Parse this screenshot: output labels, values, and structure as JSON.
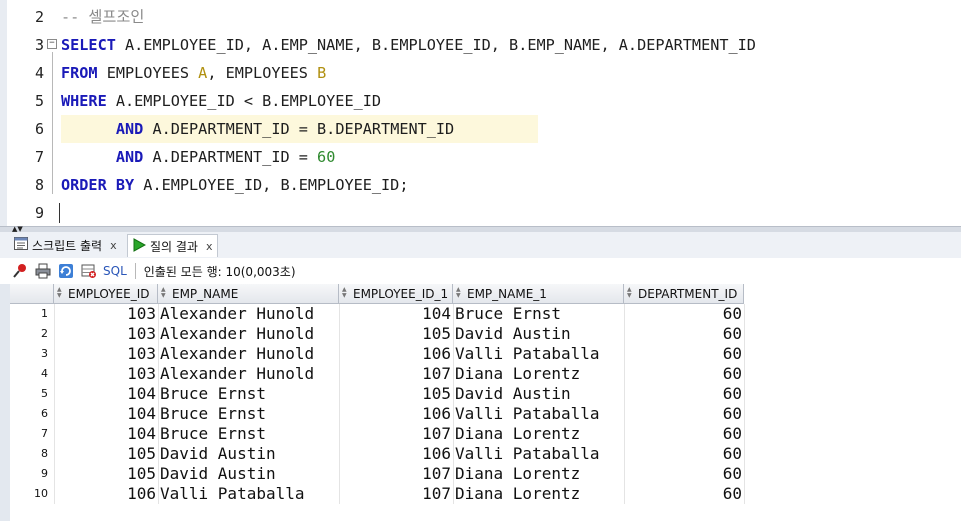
{
  "editor": {
    "lines": [
      {
        "num": "2",
        "tokens": [
          {
            "t": "-- 셀프조인",
            "c": "cm"
          }
        ]
      },
      {
        "num": "3",
        "fold": "⊟",
        "tokens": [
          {
            "t": "SELECT",
            "c": "kw"
          },
          {
            "t": " A.EMPLOYEE_ID, A.EMP_NAME, B.EMPLOYEE_ID, B.EMP_NAME, A.DEPARTMENT_ID",
            "c": ""
          }
        ]
      },
      {
        "num": "4",
        "tokens": [
          {
            "t": "FROM",
            "c": "kw"
          },
          {
            "t": " EMPLOYEES ",
            "c": ""
          },
          {
            "t": "A",
            "c": "alias"
          },
          {
            "t": ", EMPLOYEES ",
            "c": ""
          },
          {
            "t": "B",
            "c": "alias"
          }
        ]
      },
      {
        "num": "5",
        "tokens": [
          {
            "t": "WHERE",
            "c": "kw"
          },
          {
            "t": " A.EMPLOYEE_ID < B.EMPLOYEE_ID",
            "c": ""
          }
        ]
      },
      {
        "num": "6",
        "current": true,
        "tokens": [
          {
            "t": "      ",
            "c": ""
          },
          {
            "t": "AND",
            "c": "kw"
          },
          {
            "t": " A.DEPARTMENT_ID = B.DEPARTMENT_ID",
            "c": ""
          }
        ]
      },
      {
        "num": "7",
        "tokens": [
          {
            "t": "      ",
            "c": ""
          },
          {
            "t": "AND",
            "c": "kw"
          },
          {
            "t": " A.DEPARTMENT_ID = ",
            "c": ""
          },
          {
            "t": "60",
            "c": "num"
          }
        ]
      },
      {
        "num": "8",
        "tokens": [
          {
            "t": "ORDER BY",
            "c": "kw"
          },
          {
            "t": " A.EMPLOYEE_ID, B.EMPLOYEE_ID;",
            "c": ""
          }
        ]
      },
      {
        "num": "9",
        "caret": true,
        "tokens": []
      }
    ]
  },
  "tabs": [
    {
      "label": "스크립트 출력",
      "close": "x",
      "icon": "script-output-icon",
      "active": false
    },
    {
      "label": "질의 결과",
      "close": "x",
      "icon": "run-query-icon",
      "active": true
    }
  ],
  "toolbar": {
    "icons": [
      "pin-icon",
      "print-icon",
      "refresh-icon",
      "clear-icon"
    ],
    "sql_label": "SQL",
    "status": "인출된 모든 행: 10(0,003초)"
  },
  "grid": {
    "columns": [
      "EMPLOYEE_ID",
      "EMP_NAME",
      "EMPLOYEE_ID_1",
      "EMP_NAME_1",
      "DEPARTMENT_ID"
    ],
    "rows": [
      [
        "1",
        "103",
        "Alexander Hunold",
        "104",
        "Bruce Ernst",
        "60"
      ],
      [
        "2",
        "103",
        "Alexander Hunold",
        "105",
        "David Austin",
        "60"
      ],
      [
        "3",
        "103",
        "Alexander Hunold",
        "106",
        "Valli Pataballa",
        "60"
      ],
      [
        "4",
        "103",
        "Alexander Hunold",
        "107",
        "Diana Lorentz",
        "60"
      ],
      [
        "5",
        "104",
        "Bruce Ernst",
        "105",
        "David Austin",
        "60"
      ],
      [
        "6",
        "104",
        "Bruce Ernst",
        "106",
        "Valli Pataballa",
        "60"
      ],
      [
        "7",
        "104",
        "Bruce Ernst",
        "107",
        "Diana Lorentz",
        "60"
      ],
      [
        "8",
        "105",
        "David Austin",
        "106",
        "Valli Pataballa",
        "60"
      ],
      [
        "9",
        "105",
        "David Austin",
        "107",
        "Diana Lorentz",
        "60"
      ],
      [
        "10",
        "106",
        "Valli Pataballa",
        "107",
        "Diana Lorentz",
        "60"
      ]
    ]
  }
}
